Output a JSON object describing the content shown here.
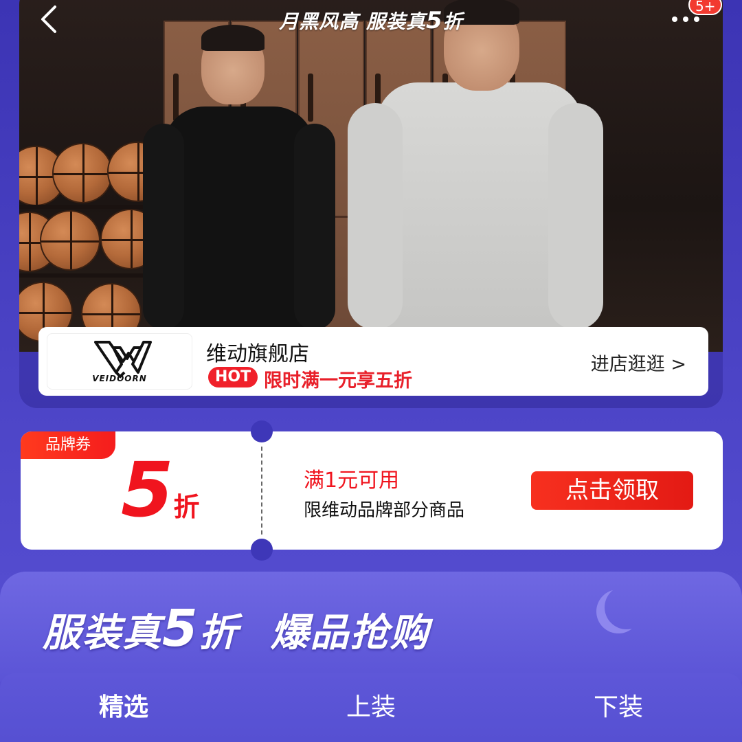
{
  "header": {
    "title_part1": "月黑风高 服装真",
    "title_num": "5",
    "title_part2": "折",
    "notification_badge": "5+"
  },
  "store": {
    "logo_text": "VEIDOORN",
    "name": "维动旗舰店",
    "hot_label": "HOT",
    "promo": "限时满一元享五折",
    "enter_label": "进店逛逛 >"
  },
  "coupon": {
    "tag": "品牌券",
    "value": "5",
    "unit": "折",
    "condition": "满1元可用",
    "scope": "限维动品牌部分商品",
    "button": "点击领取"
  },
  "banner": {
    "part1": "服装真",
    "num": "5",
    "part2": "折",
    "part3": "爆品抢购"
  },
  "tabs": [
    {
      "label": "精选",
      "active": true
    },
    {
      "label": "上装",
      "active": false
    },
    {
      "label": "下装",
      "active": false
    }
  ],
  "colors": {
    "accent_red": "#f0141e",
    "background_purple": "#4a42c4"
  }
}
